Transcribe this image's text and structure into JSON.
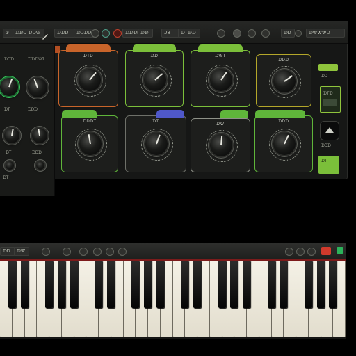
{
  "toolbar": {
    "left_labels": [
      "Ꮽ",
      "ᗪᗫᎠ ᗪᗞᏔᎢ",
      "ᗪᗫᎠ",
      "ᗪᎠᗪᎠ",
      "ᗪᗫᗪᎠᗪᎠ",
      "ᗪᗫ"
    ],
    "right_labels": [
      "ᒍ8",
      "ᗪᎢᗫᗪ",
      "ᗪᎠ",
      "ᗪᏔᏔᏔᎠ"
    ]
  },
  "left_panel": {
    "top_labels": [
      "ᗪᎠᗪ",
      "ᗪᗫᗪᏔᎢ"
    ],
    "mid_labels": [
      "ᗪᎢ",
      "ᗪᎠᗪ"
    ],
    "bottom_labels": [
      "ᗪᎢ",
      "ᗪᎠᗪ",
      "ᗪᎢ"
    ]
  },
  "modules_top": [
    {
      "label": "ᗪᎢᎠ",
      "accent": "#c8642a"
    },
    {
      "label": "ᗪᗫ",
      "accent": "#7bbf3a"
    },
    {
      "label": "ᗪᏔᎢ",
      "accent": "#7bbf3a"
    },
    {
      "label": "ᗪᎠᗪ",
      "accent": "#b4a72a"
    }
  ],
  "modules_bottom": [
    {
      "label": "ᗪᎠᗪᎢ",
      "accent": "#5fb53a"
    },
    {
      "label": "ᗪᎢ",
      "accent": "#4f58c9"
    },
    {
      "label": "ᗪᏔ",
      "accent": "#8e9188"
    },
    {
      "label": "ᗪᎠᗪ",
      "accent": "#5fb53a"
    }
  ],
  "right_panel": {
    "labels": [
      "ᗪᎠ",
      "ᗪᎢᗪ",
      "ᗪᎠᗪ",
      "ᗪᎢ"
    ],
    "accent_green": "#8fc43c"
  },
  "keyboard": {
    "bar_labels": [
      "ᗪᎠ",
      "ᗪᏔ"
    ],
    "record_color": "#d13a2c",
    "led_color": "#2bb35a",
    "white_keys": 28
  },
  "colors": {
    "panel_bg": "#161716",
    "green": "#7bbf3a",
    "orange": "#c8642a",
    "blue": "#4f58c9"
  }
}
